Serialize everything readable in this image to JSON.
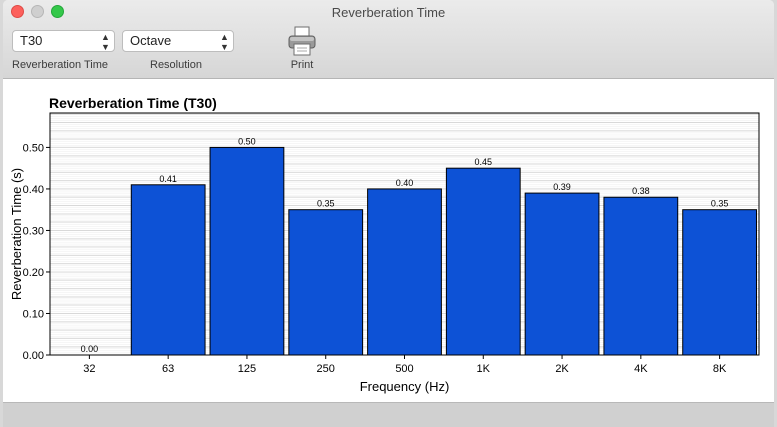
{
  "window": {
    "title": "Reverberation Time"
  },
  "toolbar": {
    "measure": {
      "value": "T30",
      "label": "Reverberation Time"
    },
    "resolution": {
      "value": "Octave",
      "label": "Resolution"
    },
    "print_label": "Print"
  },
  "chart_data": {
    "type": "bar",
    "title": "Reverberation Time (T30)",
    "xlabel": "Frequency (Hz)",
    "ylabel": "Reverberation Time (s)",
    "categories": [
      "32",
      "63",
      "125",
      "250",
      "500",
      "1K",
      "2K",
      "4K",
      "8K"
    ],
    "values": [
      0.0,
      0.41,
      0.5,
      0.35,
      0.4,
      0.45,
      0.39,
      0.38,
      0.35
    ],
    "value_labels": [
      "0.00",
      "0.41",
      "0.50",
      "0.35",
      "0.40",
      "0.45",
      "0.39",
      "0.38",
      "0.35"
    ],
    "yticks": [
      "0.00",
      "0.10",
      "0.20",
      "0.30",
      "0.40",
      "0.50"
    ],
    "ylim": [
      0,
      0.5829
    ],
    "grid": true,
    "bar_color": "#0d52d6"
  }
}
